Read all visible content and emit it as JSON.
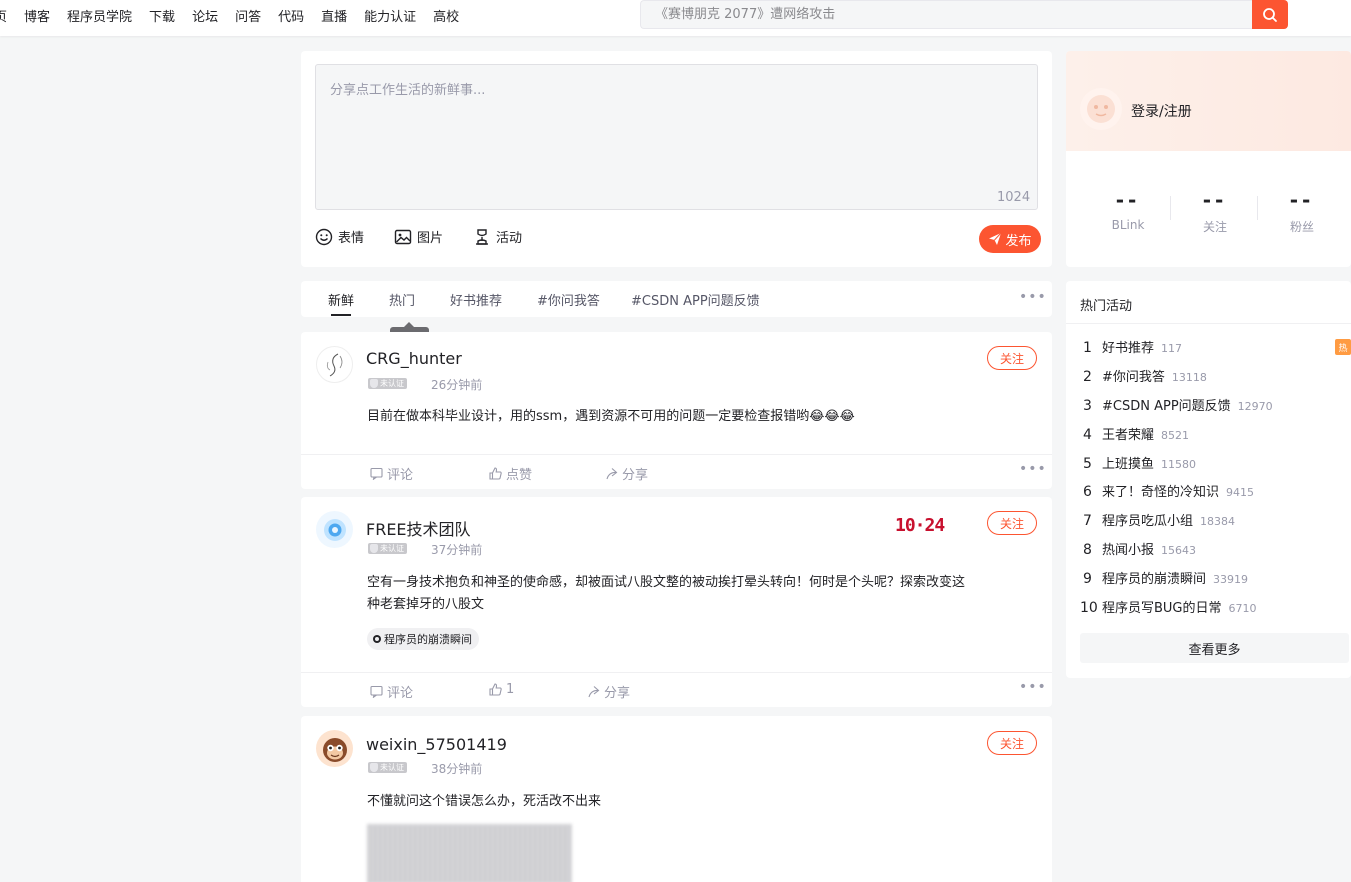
{
  "nav": {
    "items": [
      "页",
      "博客",
      "程序员学院",
      "下载",
      "论坛",
      "问答",
      "代码",
      "直播",
      "能力认证",
      "高校"
    ]
  },
  "search": {
    "placeholder": "《赛博朋克 2077》遭网络攻击",
    "icon": "search-icon"
  },
  "composer": {
    "placeholder": "分享点工作生活的新鲜事...",
    "char_count": "1024",
    "tools": [
      "表情",
      "图片",
      "活动"
    ],
    "publish_label": "发布"
  },
  "tabs": {
    "items": [
      "新鲜",
      "热门",
      "好书推荐",
      "#你问我答",
      "#CSDN APP问题反馈"
    ],
    "active": "新鲜",
    "tooltip": "热门"
  },
  "badge_label": "未认证",
  "follow_label": "关注",
  "actions": {
    "comment": "评论",
    "like": "点赞",
    "share": "分享"
  },
  "posts": [
    {
      "user": "CRG_hunter",
      "time": "26分钟前",
      "text": "目前在做本科毕业设计，用的ssm，遇到资源不可用的问题一定要检查报错哟",
      "emoji": "😂😂😂",
      "like_label": "点赞"
    },
    {
      "user": "FREE技术团队",
      "time": "37分钟前",
      "text": "空有一身技术抱负和神圣的使命感，却被面试八股文整的被动挨打晕头转向！何时是个头呢？探索改变这种老套掉牙的八股文",
      "topic": "程序员的崩溃瞬间",
      "logo": "10·24",
      "like_label": "1"
    },
    {
      "user": "weixin_57501419",
      "time": "38分钟前",
      "text": "不懂就问这个错误怎么办，死活改不出来"
    }
  ],
  "user_card": {
    "login": "登录/注册",
    "stats": [
      {
        "value": "--",
        "label": "BLink"
      },
      {
        "value": "--",
        "label": "关注"
      },
      {
        "value": "--",
        "label": "粉丝"
      }
    ]
  },
  "hot": {
    "title": "热门活动",
    "flag": "热",
    "items": [
      {
        "rank": "1",
        "name": "好书推荐",
        "count": "117"
      },
      {
        "rank": "2",
        "name": "#你问我答",
        "count": "13118"
      },
      {
        "rank": "3",
        "name": "#CSDN APP问题反馈",
        "count": "12970"
      },
      {
        "rank": "4",
        "name": "王者荣耀",
        "count": "8521"
      },
      {
        "rank": "5",
        "name": "上班摸鱼",
        "count": "11580"
      },
      {
        "rank": "6",
        "name": "来了！奇怪的冷知识",
        "count": "9415"
      },
      {
        "rank": "7",
        "name": "程序员吃瓜小组",
        "count": "18384"
      },
      {
        "rank": "8",
        "name": "热闻小报",
        "count": "15643"
      },
      {
        "rank": "9",
        "name": "程序员的崩溃瞬间",
        "count": "33919"
      },
      {
        "rank": "10",
        "name": "程序员写BUG的日常",
        "count": "6710"
      }
    ],
    "see_more": "查看更多"
  },
  "colors": {
    "accent": "#fc5531",
    "muted": "#999aaa"
  }
}
